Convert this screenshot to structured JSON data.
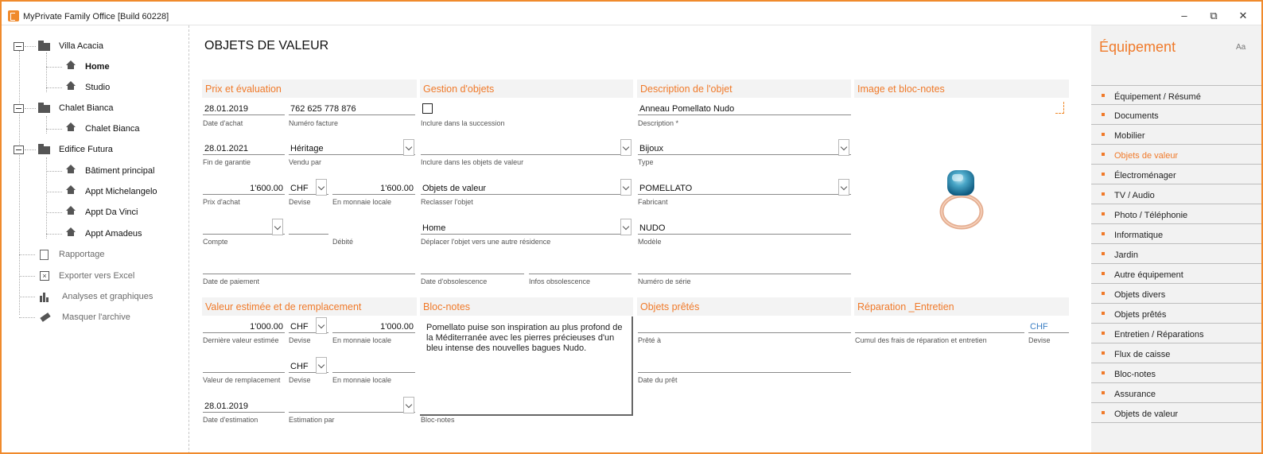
{
  "window": {
    "title": "MyPrivate Family Office [Build 60228]"
  },
  "tree": {
    "residences": [
      {
        "label": "Villa Acacia",
        "children": [
          {
            "label": "Home",
            "selected": true
          },
          {
            "label": "Studio"
          }
        ]
      },
      {
        "label": "Chalet Bianca",
        "children": [
          {
            "label": "Chalet Bianca"
          }
        ]
      },
      {
        "label": "Edifice Futura",
        "children": [
          {
            "label": "Bâtiment principal"
          },
          {
            "label": "Appt Michelangelo"
          },
          {
            "label": "Appt Da Vinci"
          },
          {
            "label": "Appt Amadeus"
          }
        ]
      }
    ],
    "tools": [
      {
        "label": "Rapportage",
        "icon": "report-icon"
      },
      {
        "label": "Exporter vers Excel",
        "icon": "excel-icon"
      },
      {
        "label": "Analyses et graphiques",
        "icon": "chart-icon"
      },
      {
        "label": "Masquer l'archive",
        "icon": "eraser-icon"
      }
    ]
  },
  "page": {
    "title": "OBJETS DE VALEUR"
  },
  "sections": {
    "prix": {
      "title": "Prix et évaluation",
      "date_achat": {
        "value": "28.01.2019",
        "label": "Date d'achat"
      },
      "numero_facture": {
        "value": "762 625 778 876",
        "label": "Numéro facture"
      },
      "fin_garantie": {
        "value": "28.01.2021",
        "label": "Fin de garantie"
      },
      "vendu_par": {
        "value": "Héritage",
        "label": "Vendu par"
      },
      "prix_achat": {
        "value": "1'600.00",
        "label": "Prix d'achat"
      },
      "devise": {
        "value": "CHF",
        "label": "Devise"
      },
      "monnaie_locale": {
        "value": "1'600.00",
        "label": "En monnaie locale"
      },
      "compte": {
        "value": "",
        "label": "Compte"
      },
      "debite": {
        "value": "",
        "label": "Débité"
      },
      "date_paiement": {
        "value": "",
        "label": "Date de paiement"
      }
    },
    "gestion": {
      "title": "Gestion d'objets",
      "succession": {
        "label": "Inclure dans la succession",
        "checked": false
      },
      "inclure_objets": {
        "value": "",
        "label": "Inclure dans les objets de valeur"
      },
      "reclasser": {
        "value": "Objets de valeur",
        "label": "Reclasser l'objet"
      },
      "deplacer": {
        "value": "Home",
        "label": "Déplacer l'objet vers une autre résidence"
      },
      "date_obsolescence": {
        "value": "",
        "label": "Date d'obsolescence"
      },
      "infos_obsolescence": {
        "value": "",
        "label": "Infos obsolescence"
      }
    },
    "description": {
      "title": "Description de l'objet",
      "description": {
        "value": "Anneau Pomellato Nudo",
        "label": "Description *"
      },
      "type": {
        "value": "Bijoux",
        "label": "Type"
      },
      "fabricant": {
        "value": "POMELLATO",
        "label": "Fabricant"
      },
      "modele": {
        "value": "NUDO",
        "label": "Modèle"
      },
      "numero_serie": {
        "value": "",
        "label": "Numéro de série"
      }
    },
    "image": {
      "title": "Image et bloc-notes"
    },
    "valeur": {
      "title": "Valeur estimée et de remplacement",
      "derniere_valeur": {
        "value": "1'000.00",
        "label": "Dernière valeur estimée"
      },
      "devise1": {
        "value": "CHF",
        "label": "Devise"
      },
      "monnaie_locale1": {
        "value": "1'000.00",
        "label": "En monnaie locale"
      },
      "valeur_remplacement": {
        "value": "",
        "label": "Valeur de remplacement"
      },
      "devise2": {
        "value": "CHF",
        "label": "Devise"
      },
      "monnaie_locale2": {
        "value": "",
        "label": "En monnaie locale"
      },
      "date_estimation": {
        "value": "28.01.2019",
        "label": "Date d'estimation"
      },
      "estimation_par": {
        "value": "",
        "label": "Estimation par"
      }
    },
    "bloc": {
      "title": "Bloc-notes",
      "text": "Pomellato puise son inspiration au plus profond de la Méditerranée avec les pierres précieuses d'un bleu intense des nouvelles bagues Nudo.",
      "label": "Bloc-notes"
    },
    "prets": {
      "title": "Objets prêtés",
      "prete_a": {
        "value": "",
        "label": "Prêté à"
      },
      "date_pret": {
        "value": "",
        "label": "Date du prêt"
      }
    },
    "reparation": {
      "title": "Réparation _Entretien",
      "cumul": {
        "value": "",
        "label": "Cumul des frais de réparation et entretien"
      },
      "devise": {
        "value": "CHF",
        "label": "Devise"
      }
    }
  },
  "right_panel": {
    "title": "Équipement",
    "aa": "Aa",
    "items": [
      {
        "label": "Équipement / Résumé"
      },
      {
        "label": "Documents"
      },
      {
        "label": "Mobilier"
      },
      {
        "label": "Objets de valeur",
        "active": true
      },
      {
        "label": "Électroménager"
      },
      {
        "label": "TV / Audio"
      },
      {
        "label": "Photo / Téléphonie"
      },
      {
        "label": "Informatique"
      },
      {
        "label": "Jardin"
      },
      {
        "label": "Autre équipement"
      },
      {
        "label": "Objets divers"
      },
      {
        "label": "Objets prêtés"
      },
      {
        "label": "Entretien / Réparations"
      },
      {
        "label": "Flux de caisse"
      },
      {
        "label": "Bloc-notes"
      },
      {
        "label": "Assurance"
      },
      {
        "label": "Objets de valeur"
      }
    ]
  },
  "colors": {
    "accent": "#f07a2a",
    "border": "#f08a2c"
  }
}
